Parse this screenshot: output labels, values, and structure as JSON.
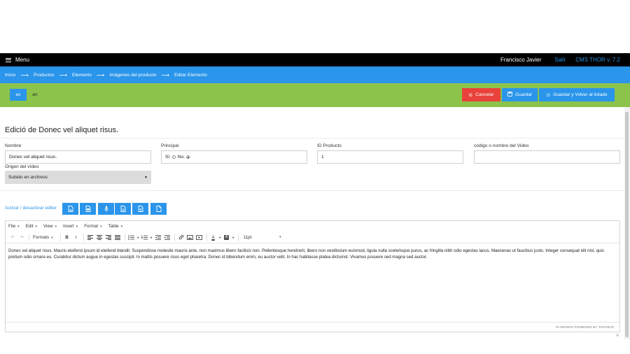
{
  "topbar": {
    "menu_label": "Menu",
    "user_name": "Francisco Javier",
    "logout_label": "Salir",
    "cms_version": "CMS THOR v. 7.2"
  },
  "breadcrumb": [
    "Inicio",
    "Productos",
    "Elemento",
    "Imágenes del producto",
    "Editar Elemento"
  ],
  "languages": {
    "active": "es",
    "other": "en"
  },
  "actions": {
    "cancel_label": "Cancelar",
    "save_label": "Guardar",
    "save_back_label": "Guardar y Volver al listado"
  },
  "form": {
    "title": "Edició de Donec vel aliquet risus.",
    "nombre_label": "Nombre",
    "nombre_value": "Donec vel aliquet risus.",
    "principal_label": "Principal",
    "principal_si": "Si:",
    "principal_no": "No:",
    "principal_selected": "No",
    "id_producto_label": "ID Producto",
    "id_producto_value": "1",
    "video_code_label": "código o nombre del Video",
    "video_code_value": "",
    "origen_label": "Origen del vídeo",
    "origen_value": "Subido en archivos"
  },
  "editor": {
    "toggle_label": "Activar / desactivar editor",
    "menus": [
      "File",
      "Edit",
      "View",
      "Insert",
      "Format",
      "Table"
    ],
    "formats_label": "Formats",
    "font_size": "11pt",
    "content": "Donec vel aliquet risus. Mauris eleifend ipsum id eleifend blandit. Suspendisse molestie mauris ante, non maximus libero facilisis non. Pellentesque hendrerit, libero non vestibulum euismod, ligula nulla scelerisque purus, ac fringilla nibh odio egestas lacus. Maecenas ut faucibus justo. Integer consequat elit nisl, quis pretium odio ornare eu. Curabitur dictum augue in egestas suscipit. In mattis posuere risus eget pharetra. Donec id bibendum enim, eu auctor velit. In hac habitasse platea dictumst. Vivamus posuere sed magna sed auctor.",
    "status": "76 WORDS POWERED BY TINYMCE"
  },
  "colors": {
    "topbar": "#000000",
    "breadcrumb": "#2a95ea",
    "actionbar": "#8cc34b",
    "cancel": "#e8423b",
    "primary": "#2a95ea"
  }
}
